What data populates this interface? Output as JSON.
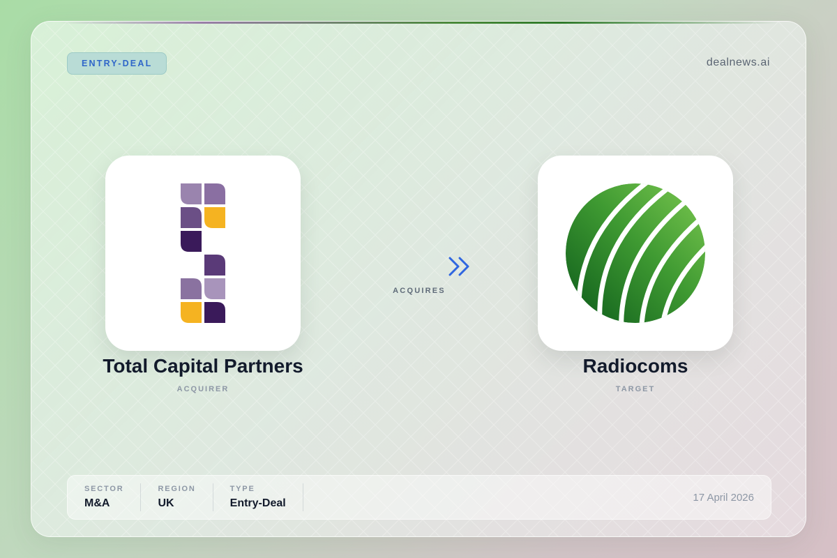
{
  "badge": "ENTRY-DEAL",
  "brand": "dealnews.ai",
  "acquirer": {
    "name": "Total Capital Partners",
    "role": "ACQUIRER",
    "logo_icon": "total-capital-partners-logo"
  },
  "target": {
    "name": "Radiocoms",
    "role": "TARGET",
    "logo_icon": "radiocoms-globe-logo"
  },
  "relation": {
    "label": "ACQUIRES",
    "icon": "double-chevron-arrow-icon"
  },
  "meta": [
    {
      "label": "SECTOR",
      "value": "M&A"
    },
    {
      "label": "REGION",
      "value": "UK"
    },
    {
      "label": "TYPE",
      "value": "Entry-Deal"
    }
  ],
  "date": "17 April 2026",
  "colors": {
    "accent_blue": "#2f66c9",
    "acquirer_purple_dark": "#3a1a5a",
    "acquirer_purple_mid": "#6b4f86",
    "acquirer_purple_light": "#9a84ae",
    "acquirer_gold": "#f5b321",
    "target_green_light": "#6dc04a",
    "target_green_dark": "#0c5a1a"
  }
}
